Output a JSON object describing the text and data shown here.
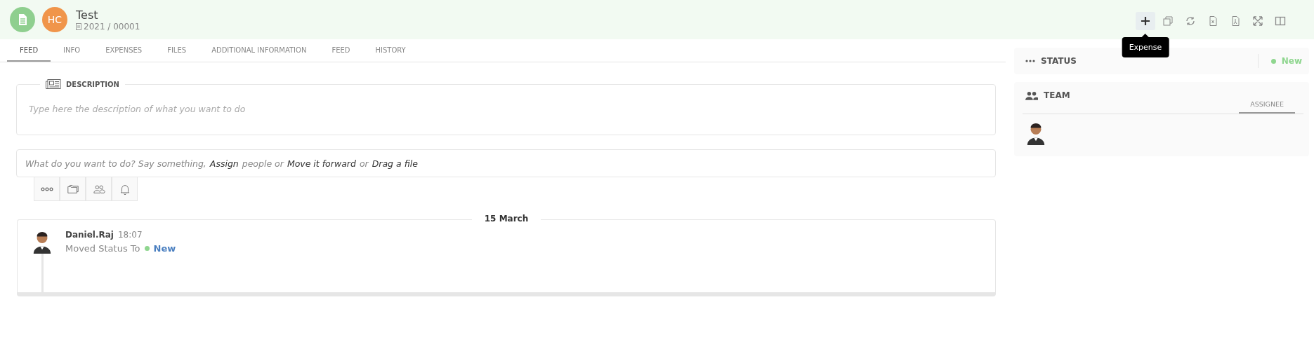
{
  "header": {
    "initials": "HC",
    "title": "Test",
    "number": "2021 / 00001",
    "actions": [
      {
        "kind": "plus",
        "selected": true
      },
      {
        "kind": "copy",
        "selected": false
      },
      {
        "kind": "refresh",
        "selected": false
      },
      {
        "kind": "excel",
        "selected": false
      },
      {
        "kind": "pdf",
        "selected": false
      },
      {
        "kind": "expand",
        "selected": false
      },
      {
        "kind": "columns",
        "selected": false
      }
    ],
    "tooltip": "Expense"
  },
  "tabs": [
    {
      "label": "FEED",
      "selected": true
    },
    {
      "label": "INFO",
      "selected": false
    },
    {
      "label": "EXPENSES",
      "selected": false
    },
    {
      "label": "FILES",
      "selected": false
    },
    {
      "label": "ADDITIONAL INFORMATION",
      "selected": false
    },
    {
      "label": "FEED",
      "selected": false
    },
    {
      "label": "HISTORY",
      "selected": false
    }
  ],
  "description": {
    "label": "DESCRIPTION",
    "placeholder": "Type here the description of what you want to do"
  },
  "composer": {
    "parts": [
      {
        "text": "What do you want to do? Say something,",
        "kind": "plain"
      },
      {
        "text": "Assign",
        "kind": "link"
      },
      {
        "text": "people or",
        "kind": "plain"
      },
      {
        "text": "Move it forward",
        "kind": "link"
      },
      {
        "text": "or",
        "kind": "plain"
      },
      {
        "text": "Drag a file",
        "kind": "link"
      }
    ]
  },
  "toolbar": [
    {
      "kind": "more"
    },
    {
      "kind": "folder"
    },
    {
      "kind": "people"
    },
    {
      "kind": "bell"
    }
  ],
  "feed": {
    "date": "15 March",
    "entries": [
      {
        "author": "Daniel.Raj",
        "time": "18:07",
        "action": "Moved Status To",
        "status": "New",
        "color": "#8fd68f"
      }
    ]
  },
  "status": {
    "label": "STATUS",
    "value": "New",
    "color": "#8fd68f"
  },
  "team": {
    "label": "TEAM",
    "tabs": [
      {
        "label": "ASSIGNEE",
        "selected": true
      }
    ],
    "members": [
      {
        "kind": "avatar"
      }
    ]
  }
}
